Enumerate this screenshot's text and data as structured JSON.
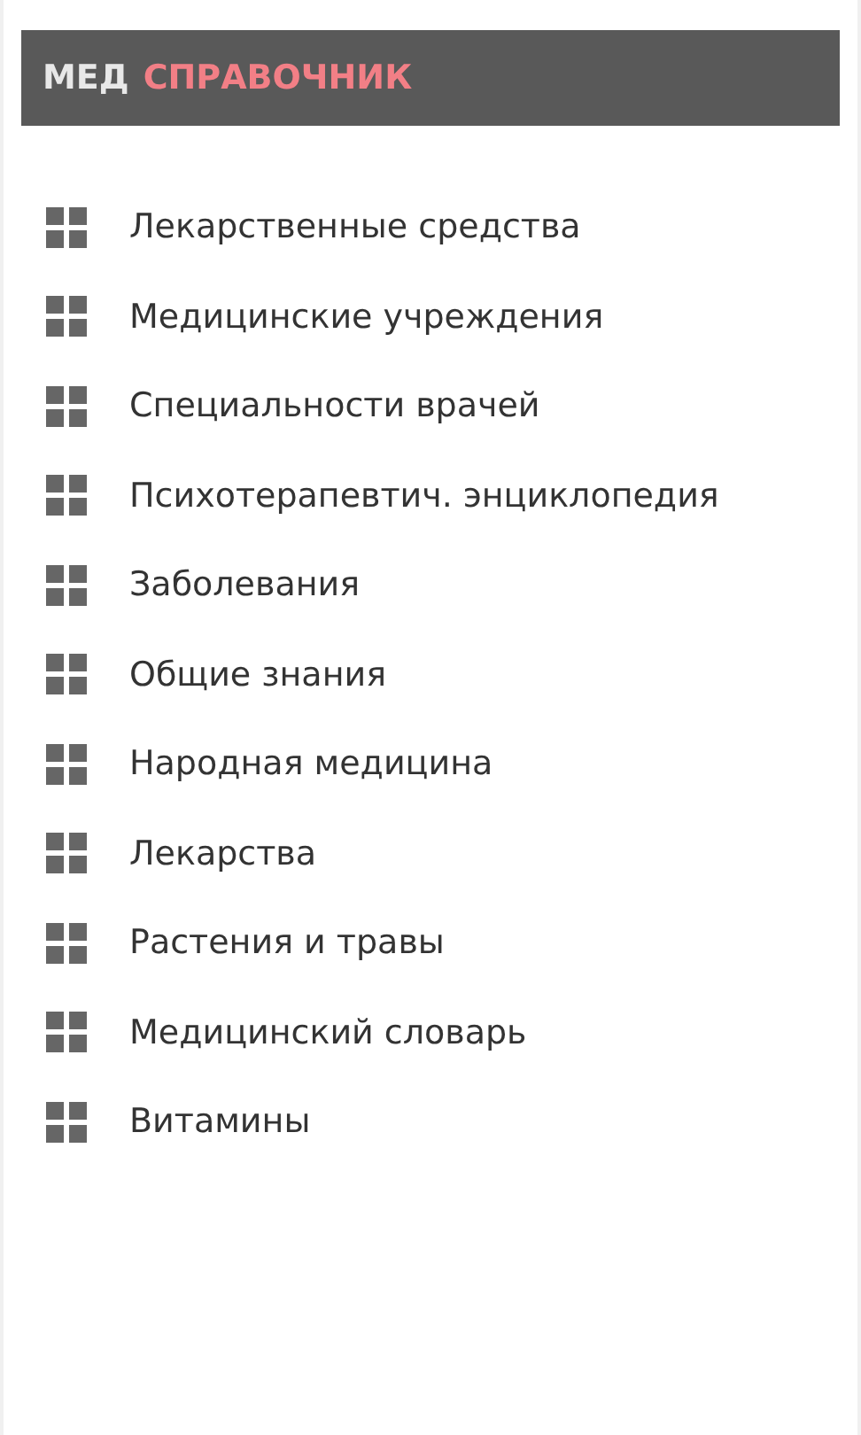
{
  "header": {
    "title_prefix": "МЕД",
    "title_accent": "СПРАВОЧНИК"
  },
  "menu": [
    {
      "label": "Лекарственные средства"
    },
    {
      "label": "Медицинские учреждения"
    },
    {
      "label": "Специальности врачей"
    },
    {
      "label": "Психотерапевтич. энциклопедия"
    },
    {
      "label": "Заболевания"
    },
    {
      "label": "Общие знания"
    },
    {
      "label": "Народная медицина"
    },
    {
      "label": "Лекарства"
    },
    {
      "label": "Растения и травы"
    },
    {
      "label": "Медицинский словарь"
    },
    {
      "label": "Витамины"
    }
  ]
}
